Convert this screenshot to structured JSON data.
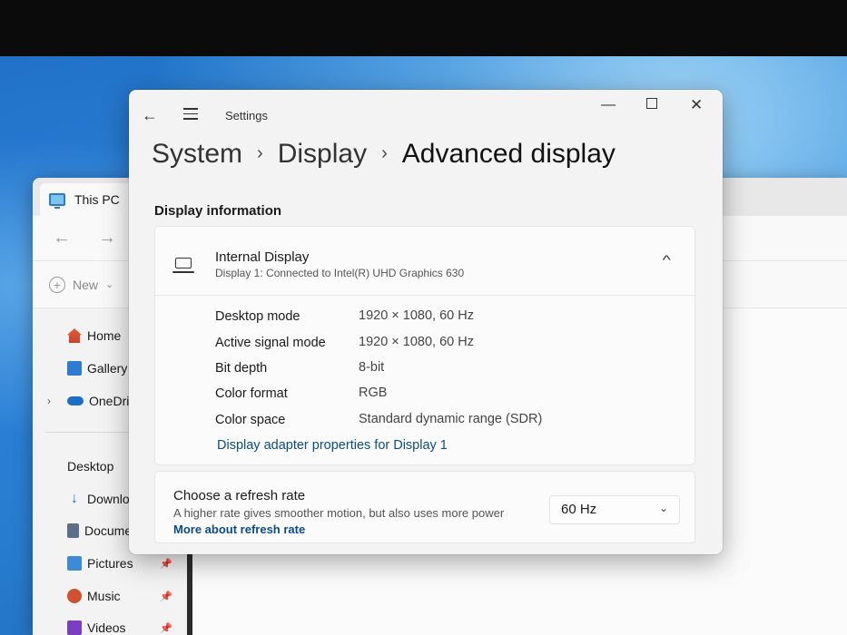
{
  "explorer": {
    "tab_title": "This PC",
    "nav": {
      "back": "←",
      "forward": "→"
    },
    "cmd_new": "New",
    "cmd_new_chevron": "⌄",
    "sidebar": [
      {
        "label": "Home",
        "icon": "home-icon"
      },
      {
        "label": "Gallery",
        "icon": "gallery-icon"
      },
      {
        "label": "OneDrive",
        "icon": "onedrive-icon",
        "expandable": true
      },
      {
        "label": "Desktop",
        "icon": "desktop-icon",
        "pinned": true
      },
      {
        "label": "Downloads",
        "icon": "downloads-icon",
        "pinned": true
      },
      {
        "label": "Documents",
        "icon": "documents-icon",
        "pinned": true
      },
      {
        "label": "Pictures",
        "icon": "pictures-icon",
        "pinned": true
      },
      {
        "label": "Music",
        "icon": "music-icon",
        "pinned": true
      },
      {
        "label": "Videos",
        "icon": "videos-icon",
        "pinned": true
      }
    ]
  },
  "settings": {
    "app_title": "Settings",
    "window_controls": {
      "minimize": "—",
      "maximize": "",
      "close": "✕"
    },
    "breadcrumb": [
      "System",
      "Display",
      "Advanced display"
    ],
    "breadcrumb_separator": "›",
    "section_title": "Display information",
    "display": {
      "name": "Internal Display",
      "subtitle": "Display 1: Connected to Intel(R) UHD Graphics 630",
      "rows": [
        {
          "label": "Desktop mode",
          "value": "1920 × 1080, 60 Hz"
        },
        {
          "label": "Active signal mode",
          "value": "1920 × 1080, 60 Hz"
        },
        {
          "label": "Bit depth",
          "value": "8-bit"
        },
        {
          "label": "Color format",
          "value": "RGB"
        },
        {
          "label": "Color space",
          "value": "Standard dynamic range (SDR)"
        }
      ],
      "adapter_link": "Display adapter properties for Display 1"
    },
    "refresh": {
      "title": "Choose a refresh rate",
      "description": "A higher rate gives smoother motion, but also uses more power",
      "link": "More about refresh rate",
      "selected": "60 Hz"
    }
  },
  "colors": {
    "accent_link": "#0a4c8c",
    "window_bg": "#f3f3f3",
    "card_bg": "#fbfbfb"
  }
}
